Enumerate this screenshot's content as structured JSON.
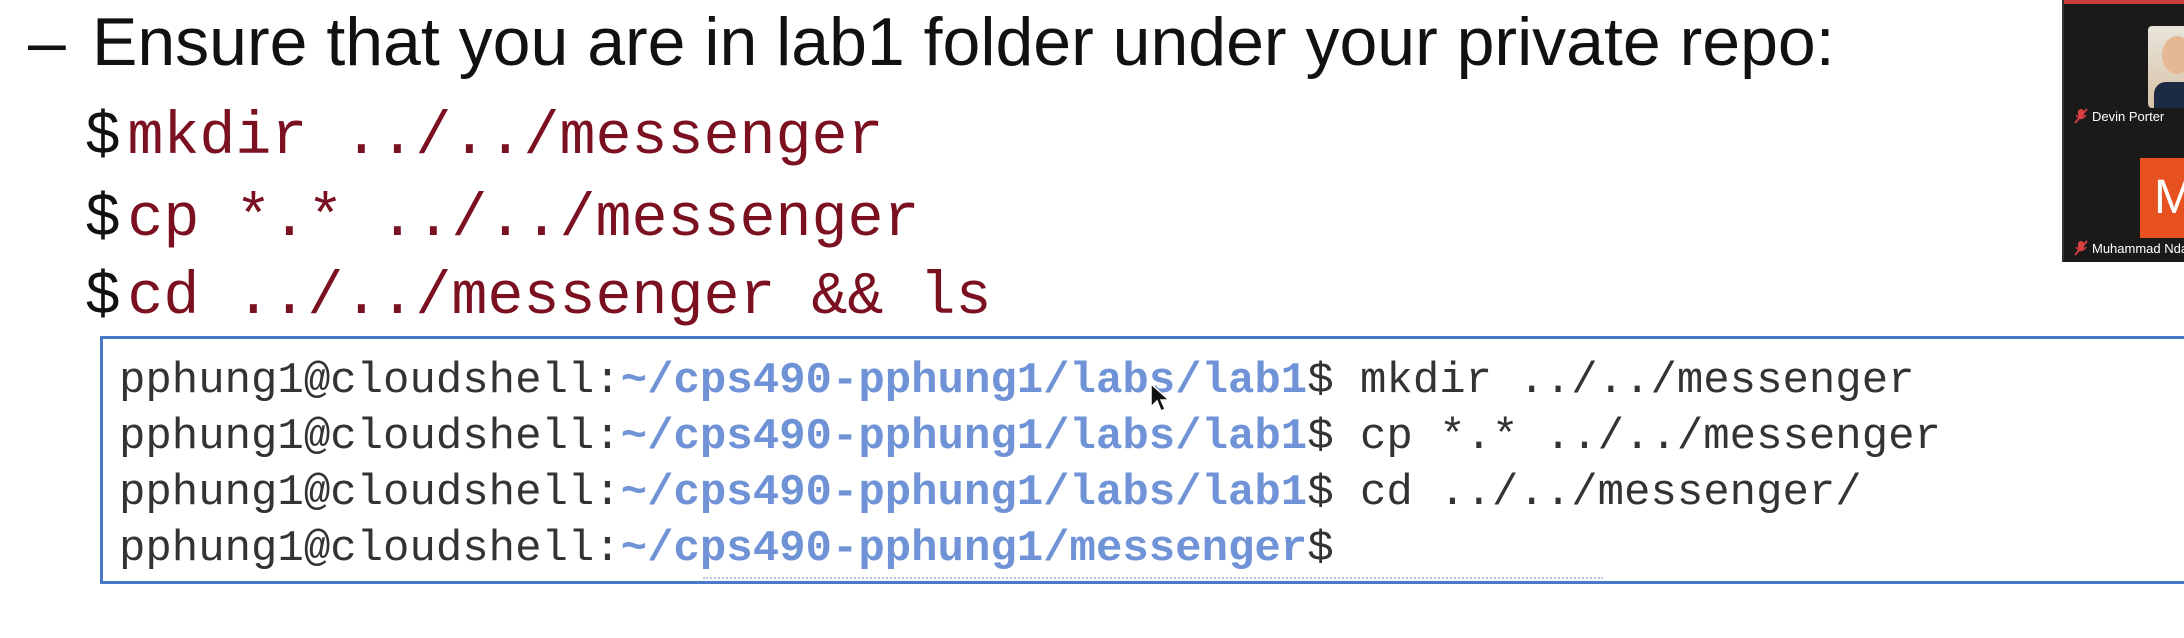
{
  "slide": {
    "bullet_dash": "–",
    "bullet_text": "Ensure that you are in lab1 folder under your private repo:",
    "commands": [
      {
        "prompt": "$",
        "code": "mkdir ../../messenger"
      },
      {
        "prompt": "$",
        "code": "cp *.* ../../messenger"
      },
      {
        "prompt": "$",
        "code": "cd ../../messenger && ls"
      }
    ]
  },
  "terminal": {
    "lines": [
      {
        "user": "pphung1@cloudshell:",
        "path": "~/cps490-pphung1/labs/lab1",
        "command": "$ mkdir ../../messenger"
      },
      {
        "user": "pphung1@cloudshell:",
        "path": "~/cps490-pphung1/labs/lab1",
        "command": "$ cp *.* ../../messenger"
      },
      {
        "user": "pphung1@cloudshell:",
        "path": "~/cps490-pphung1/labs/lab1",
        "command": "$ cd ../../messenger/"
      },
      {
        "user": "pphung1@cloudshell:",
        "path": "~/cps490-pphung1/messenger",
        "command": "$"
      }
    ]
  },
  "video_panel": {
    "participants": [
      {
        "name": "Devin Porter",
        "avatar": "photo",
        "muted": true
      },
      {
        "name": "Muhammad Nda",
        "avatar_letter": "M",
        "avatar_color": "#e6511f",
        "muted": true
      }
    ]
  },
  "colors": {
    "command_text": "#7a1020",
    "terminal_path": "#6f93d6",
    "terminal_border": "#4a78c8"
  }
}
